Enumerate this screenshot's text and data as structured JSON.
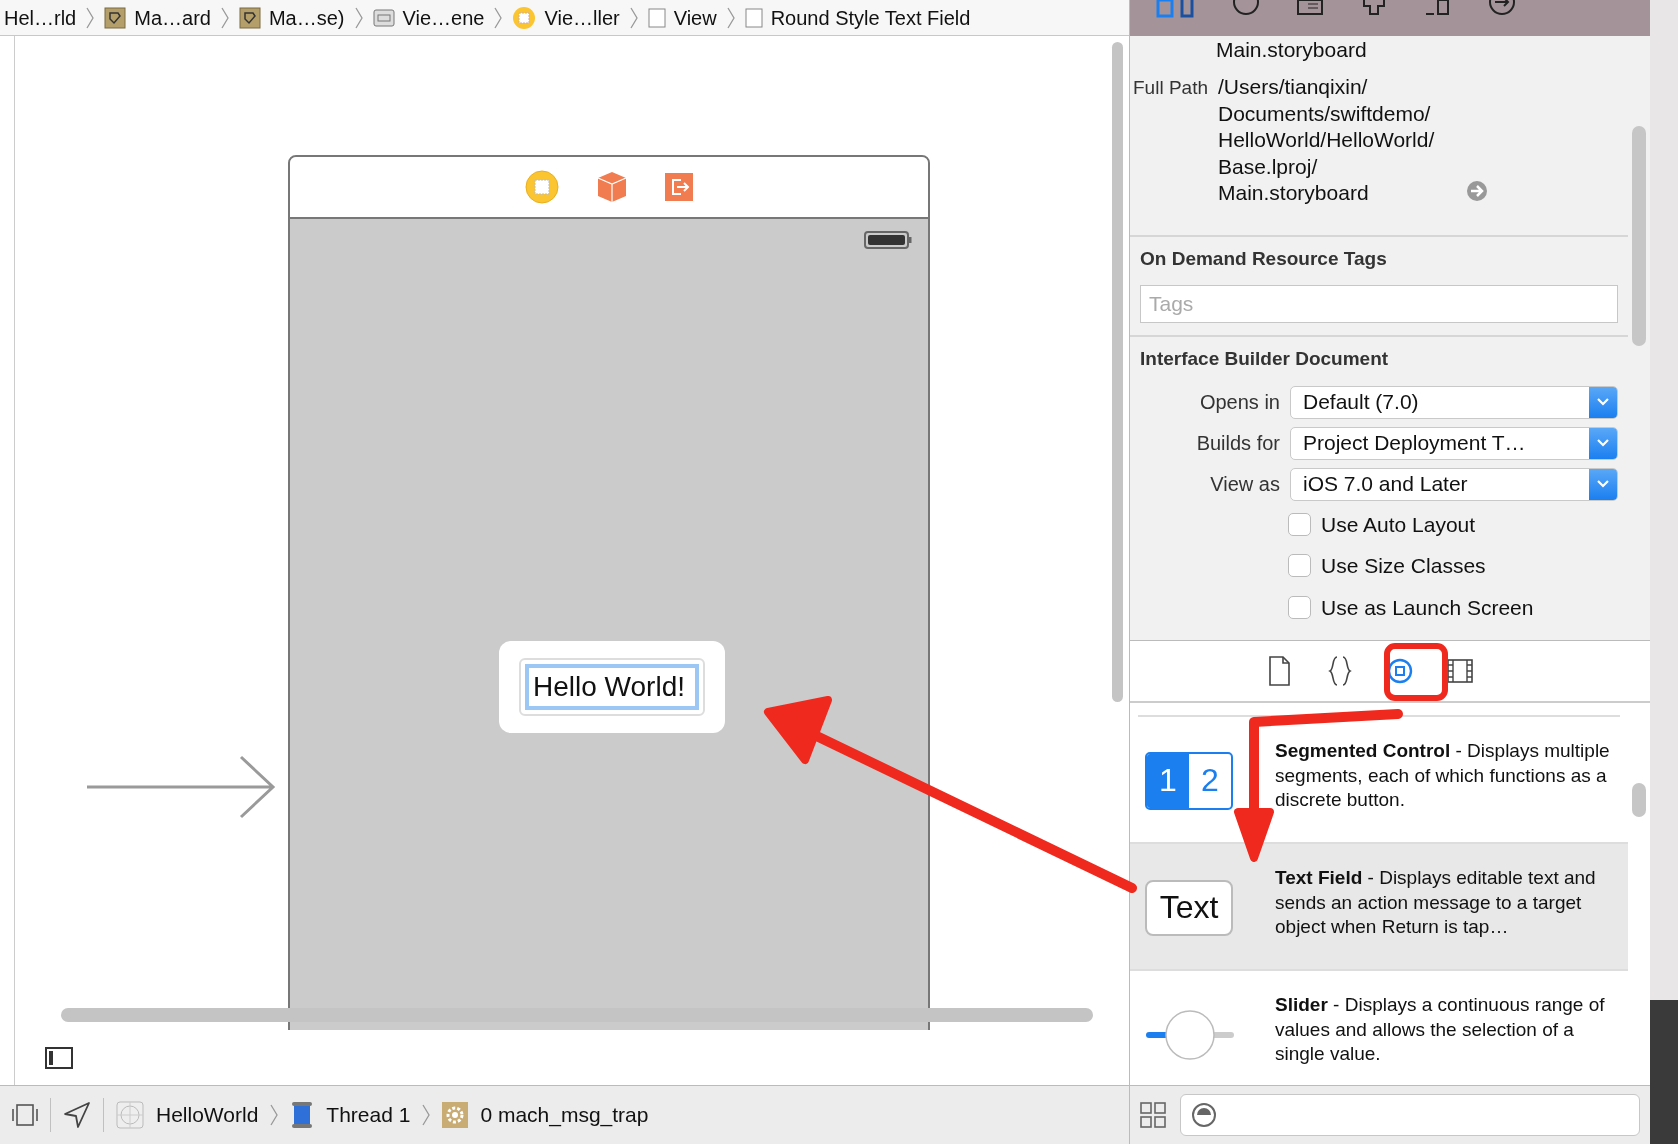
{
  "breadcrumb": [
    {
      "label": "Hel…rld",
      "kind": "project"
    },
    {
      "label": "Ma…ard",
      "kind": "storyboard"
    },
    {
      "label": "Ma…se)",
      "kind": "storyboard"
    },
    {
      "label": "Vie…ene",
      "kind": "scene"
    },
    {
      "label": "Vie…ller",
      "kind": "controller"
    },
    {
      "label": "View",
      "kind": "view"
    },
    {
      "label": "Round Style Text Field",
      "kind": "view"
    }
  ],
  "canvas": {
    "text_field": {
      "value": "Hello World!",
      "selected": true
    }
  },
  "inspector": {
    "file_name": "Main.storyboard",
    "full_path_label": "Full Path",
    "full_path": [
      "/Users/tianqixin/",
      "Documents/swiftdemo/",
      "HelloWorld/HelloWorld/",
      "Base.lproj/",
      "Main.storyboard"
    ],
    "tags_section": {
      "title": "On Demand Resource Tags",
      "placeholder": "Tags"
    },
    "document_section": {
      "title": "Interface Builder Document",
      "popups": [
        {
          "label": "Opens in",
          "value": "Default (7.0)"
        },
        {
          "label": "Builds for",
          "value": "Project Deployment T…"
        },
        {
          "label": "View as",
          "value": "iOS 7.0 and Later"
        }
      ],
      "checkboxes": [
        {
          "label": "Use Auto Layout",
          "checked": false
        },
        {
          "label": "Use Size Classes",
          "checked": false
        },
        {
          "label": "Use as Launch Screen",
          "checked": false
        }
      ]
    }
  },
  "library": {
    "tabs": [
      {
        "kind": "file",
        "selected": false
      },
      {
        "kind": "braces",
        "selected": false
      },
      {
        "kind": "object",
        "selected": true
      },
      {
        "kind": "media",
        "selected": false
      }
    ],
    "items": [
      {
        "kind": "segmented",
        "preview": [
          "1",
          "2"
        ],
        "title": "Segmented Control",
        "description": " - Displays multiple segments, each of which functions as a discrete button.",
        "selected": false
      },
      {
        "kind": "text_field",
        "preview": [
          "Text"
        ],
        "title": "Text Field",
        "description": " - Displays editable text and sends an action message to a target object when Return is tap…",
        "selected": true
      },
      {
        "kind": "slider",
        "title": "Slider",
        "description": " - Displays a continuous range of values and allows the selection of a single value.",
        "selected": false
      }
    ]
  },
  "debug_bar": {
    "items": [
      {
        "label": "HelloWorld",
        "kind": "app"
      },
      {
        "label": "Thread 1",
        "kind": "thread"
      },
      {
        "label": "0 mach_msg_trap",
        "kind": "frame"
      }
    ]
  }
}
